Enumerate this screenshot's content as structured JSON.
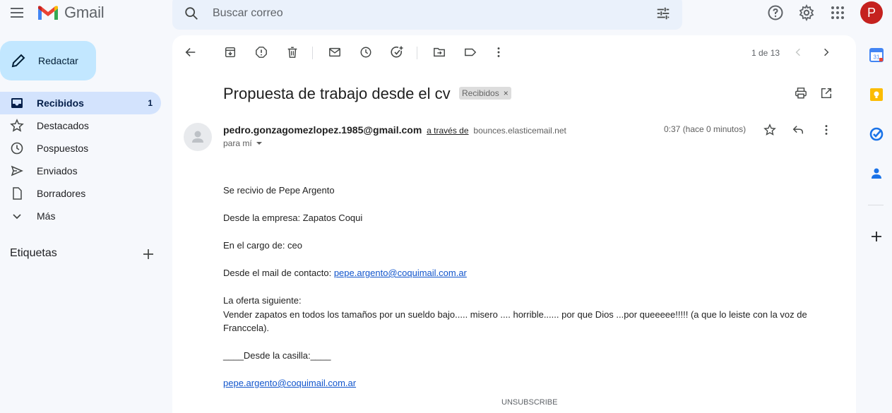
{
  "app": {
    "name": "Gmail"
  },
  "search": {
    "placeholder": "Buscar correo"
  },
  "user": {
    "initial": "P"
  },
  "compose": {
    "label": "Redactar"
  },
  "sidebar": {
    "items": [
      {
        "label": "Recibidos",
        "count": "1",
        "icon": "inbox-icon"
      },
      {
        "label": "Destacados",
        "icon": "star-icon"
      },
      {
        "label": "Pospuestos",
        "icon": "clock-icon"
      },
      {
        "label": "Enviados",
        "icon": "send-icon"
      },
      {
        "label": "Borradores",
        "icon": "draft-icon"
      },
      {
        "label": "Más",
        "icon": "chevron-down-icon"
      }
    ],
    "labels_heading": "Etiquetas"
  },
  "toolbar": {
    "pager": "1 de 13"
  },
  "message": {
    "subject": "Propuesta de trabajo desde el cv",
    "label_chip": "Recibidos",
    "sender_email": "pedro.gonzagomezlopez.1985@gmail.com",
    "via_text": "a través de",
    "via_domain": "bounces.elasticemail.net",
    "to": "para mí",
    "time": "0:37 (hace 0 minutos)",
    "body": {
      "line1": "Se recivio de Pepe Argento",
      "line2": "Desde la empresa: Zapatos Coqui",
      "line3": "En el cargo de: ceo",
      "line4_prefix": "Desde el mail de contacto: ",
      "line4_link": "pepe.argento@coquimail.com.ar",
      "line5": "La oferta siguiente:",
      "line6": "Vender zapatos en todos los tamaños por un sueldo bajo..... misero .... horrible...... por que Dios ...por queeeee!!!!! (a que lo leiste con la voz de Franccela).",
      "line7": "____Desde la casilla:____",
      "line8_link": "pepe.argento@coquimail.com.ar"
    },
    "unsubscribe": "UNSUBSCRIBE"
  },
  "colors": {
    "background": "#f6f8fc",
    "compose_bg": "#c2e7ff",
    "active_nav": "#d3e3fd",
    "search_bg": "#eaf1fb",
    "avatar": "#c5221f",
    "link": "#1155cc"
  }
}
